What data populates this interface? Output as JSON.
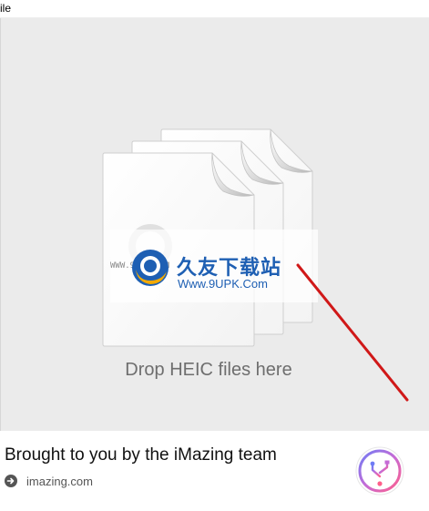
{
  "menu": {
    "file_label": "ile"
  },
  "drop_zone": {
    "instruction": "Drop HEIC files here",
    "icon": "stacked-documents-icon"
  },
  "watermark": {
    "prefix": "WWW.9UPK.COM",
    "brand": "久友下载站",
    "url": "Www.9UPK.Com"
  },
  "footer": {
    "title": "Brought to you by the iMazing team",
    "link_icon": "arrow-right-circle-icon",
    "link_text": "imazing.com",
    "logo_icon": "imazing-usb-logo-icon"
  },
  "colors": {
    "drop_area_bg": "#ebebeb",
    "annotation_line": "#d01818",
    "watermark_blue": "#1e5fb3"
  }
}
